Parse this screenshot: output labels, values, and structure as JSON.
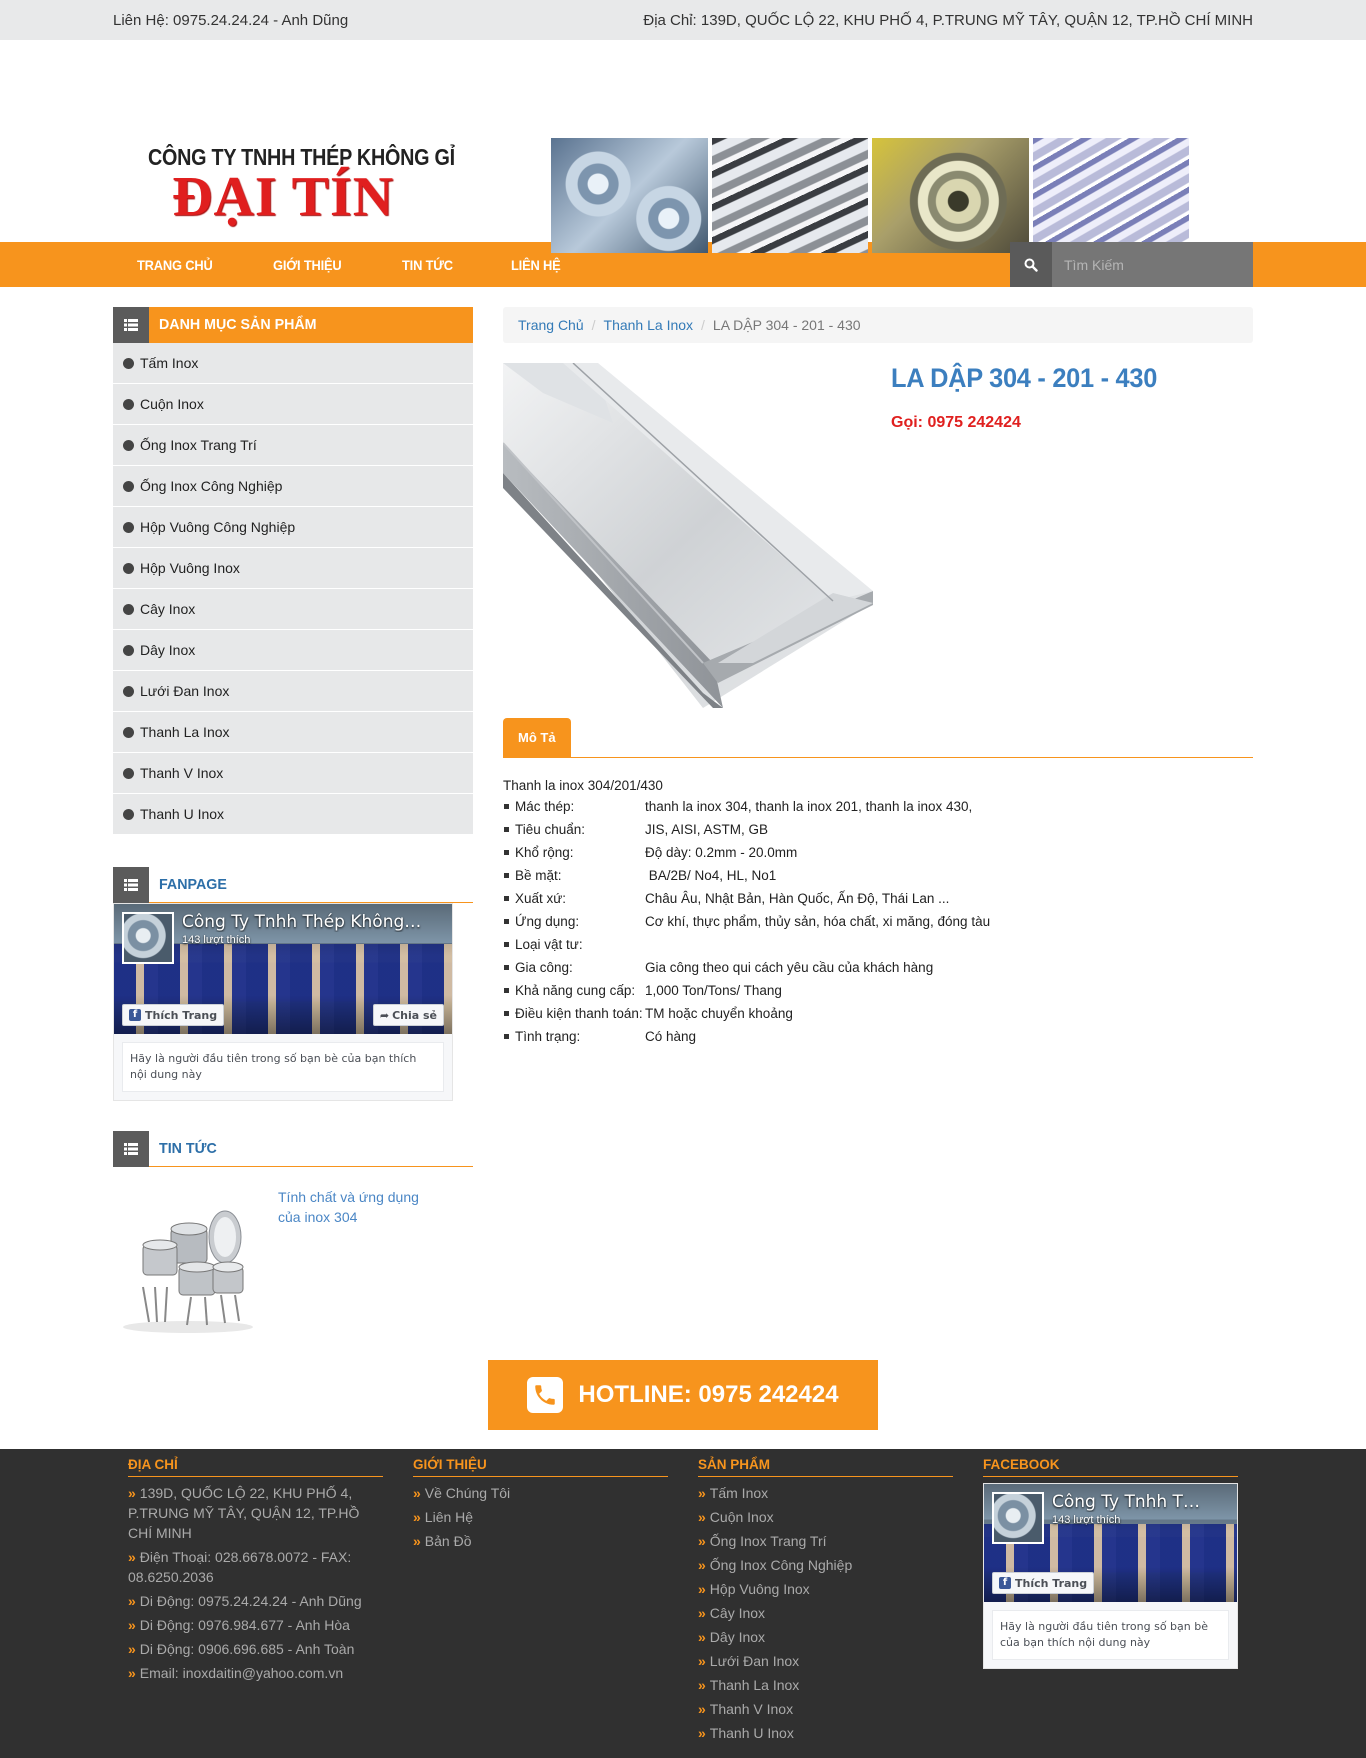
{
  "topbar": {
    "contact": "Liên Hệ: 0975.24.24.24 - Anh Dũng",
    "address": "Địa Chỉ: 139D, QUỐC LỘ 22, KHU PHỐ 4, P.TRUNG MỸ TÂY, QUẬN 12, TP.HỒ CHÍ MINH"
  },
  "logo": {
    "line1": "CÔNG TY TNHH THÉP KHÔNG GỈ",
    "line2": "ĐẠI TÍN"
  },
  "nav": {
    "items": [
      "TRANG CHỦ",
      "GIỚI THIỆU",
      "TIN TỨC",
      "LIÊN HỆ"
    ],
    "search_placeholder": "Tìm Kiếm"
  },
  "sidebar": {
    "categories_title": "DANH MỤC SẢN PHẨM",
    "categories": [
      "Tấm Inox",
      "Cuộn Inox",
      "Ống Inox Trang Trí",
      "Ống Inox Công Nghiệp",
      "Hộp Vuông Công Nghiệp",
      "Hộp Vuông Inox",
      "Cây Inox",
      "Dây Inox",
      "Lưới Đan Inox",
      "Thanh La Inox",
      "Thanh V Inox",
      "Thanh U Inox"
    ],
    "fanpage_title": "FANPAGE",
    "fanpage": {
      "name": "Công Ty Tnhh Thép Không Gỉ Đại Tín",
      "likes": "143 lượt thích",
      "like_btn": "Thích Trang",
      "share_btn": "Chia sẻ",
      "note": "Hãy là người đầu tiên trong số bạn bè của bạn thích nội dung này"
    },
    "news_title": "TIN TỨC",
    "news": [
      {
        "title": "Tính chất và ứng dụng của inox 304"
      }
    ]
  },
  "breadcrumb": {
    "home": "Trang Chủ",
    "category": "Thanh La Inox",
    "current": "LA DẬP 304 - 201 - 430"
  },
  "product": {
    "title": "LA DẬP 304 - 201 - 430",
    "call": "Gọi: 0975 242424",
    "tab": "Mô Tả",
    "desc_title": "Thanh la inox 304/201/430",
    "specs": [
      {
        "k": "Mác thép:",
        "v": "thanh la inox 304, thanh la inox 201, thanh la inox 430,"
      },
      {
        "k": "Tiêu chuẩn:",
        "v": "JIS, AISI, ASTM, GB"
      },
      {
        "k": "Khổ rộng:",
        "v": "Độ dày: 0.2mm - 20.0mm"
      },
      {
        "k": "Bề mặt:",
        "v": " BA/2B/ No4, HL, No1"
      },
      {
        "k": "Xuất xứ:",
        "v": "Châu Âu, Nhật Bản, Hàn Quốc, Ấn Độ, Thái Lan ..."
      },
      {
        "k": "Ứng dụng:",
        "v": "Cơ khí, thực phẩm, thủy sản, hóa chất, xi măng, đóng tàu"
      },
      {
        "k": "Loại vật tư:",
        "v": ""
      },
      {
        "k": "Gia công:",
        "v": "Gia công theo qui cách yêu cầu của khách hàng"
      },
      {
        "k": "Khả năng cung cấp:",
        "v": "1,000 Ton/Tons/ Thang"
      },
      {
        "k": "Điều kiện thanh toán:",
        "v": "TM hoặc chuyển khoảng"
      },
      {
        "k": "Tình trạng:",
        "v": "Có hàng"
      }
    ]
  },
  "hotline": "HOTLINE: 0975 242424",
  "footer": {
    "address_title": "ĐỊA CHỈ",
    "address_items": [
      "139D, QUỐC LỘ 22, KHU PHỐ 4, P.TRUNG MỸ TÂY, QUẬN 12, TP.HỒ CHÍ MINH",
      "Điện Thoại: 028.6678.0072 - FAX: 08.6250.2036",
      "Di Động: 0975.24.24.24 - Anh Dũng",
      "Di Động: 0976.984.677 - Anh Hòa",
      "Di Động: 0906.696.685 - Anh Toàn",
      "Email: inoxdaitin@yahoo.com.vn"
    ],
    "intro_title": "GIỚI THIỆU",
    "intro_items": [
      "Về Chúng Tôi",
      "Liên Hệ",
      "Bản Đồ"
    ],
    "products_title": "SẢN PHẨM",
    "products_items": [
      "Tấm Inox",
      "Cuộn Inox",
      "Ống Inox Trang Trí",
      "Ống Inox Công Nghiệp",
      "Hộp Vuông Inox",
      "Cây Inox",
      "Dây Inox",
      "Lưới Đan Inox",
      "Thanh La Inox",
      "Thanh V Inox",
      "Thanh U Inox"
    ],
    "facebook_title": "FACEBOOK",
    "fb_name": "Công Ty Tnhh Thép Không Gỉ Đại Tín",
    "fb_likes": "143 lượt thích",
    "fb_like_btn": "Thích Trang",
    "fb_note": "Hãy là người đầu tiên trong số bạn bè của bạn thích nội dung này"
  },
  "colors": {
    "accent": "#f7941d",
    "link": "#337ab7",
    "title": "#3c7fbf",
    "call": "#e0201f",
    "footer_bg": "#303030"
  }
}
